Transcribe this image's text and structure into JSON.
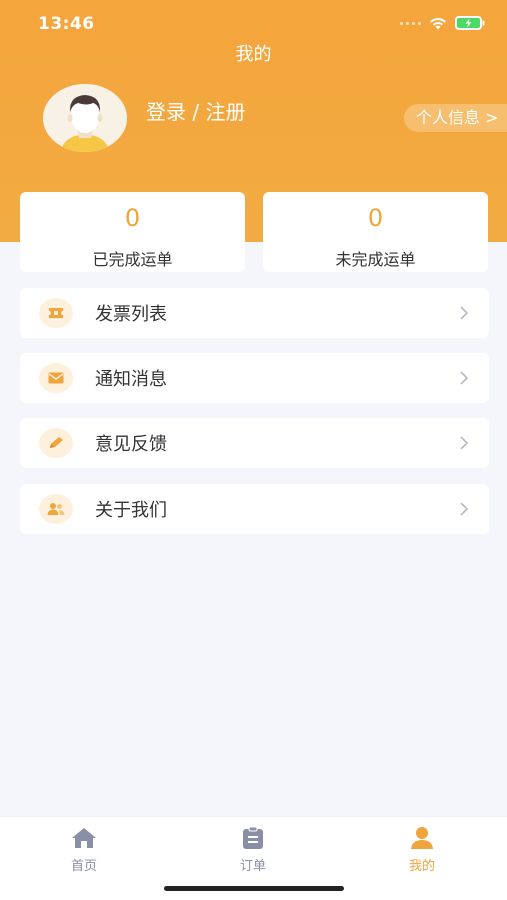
{
  "status_bar": {
    "time": "13:46"
  },
  "page_title": "我的",
  "profile": {
    "login_label": "登录 / 注册",
    "info_label": "个人信息 >"
  },
  "stats": [
    {
      "value": "0",
      "label": "已完成运单"
    },
    {
      "value": "0",
      "label": "未完成运单"
    }
  ],
  "menu": [
    {
      "label": "发票列表",
      "icon": "ticket-icon"
    },
    {
      "label": "通知消息",
      "icon": "mail-icon"
    },
    {
      "label": "意见反馈",
      "icon": "pencil-icon"
    },
    {
      "label": "关于我们",
      "icon": "people-icon"
    }
  ],
  "tabbar": [
    {
      "label": "首页",
      "icon": "home-icon",
      "active": false
    },
    {
      "label": "订单",
      "icon": "clipboard-icon",
      "active": false
    },
    {
      "label": "我的",
      "icon": "user-icon",
      "active": true
    }
  ],
  "colors": {
    "accent": "#f0a43c",
    "tab_inactive": "#8a8fa8",
    "background": "#f4f6fc"
  }
}
